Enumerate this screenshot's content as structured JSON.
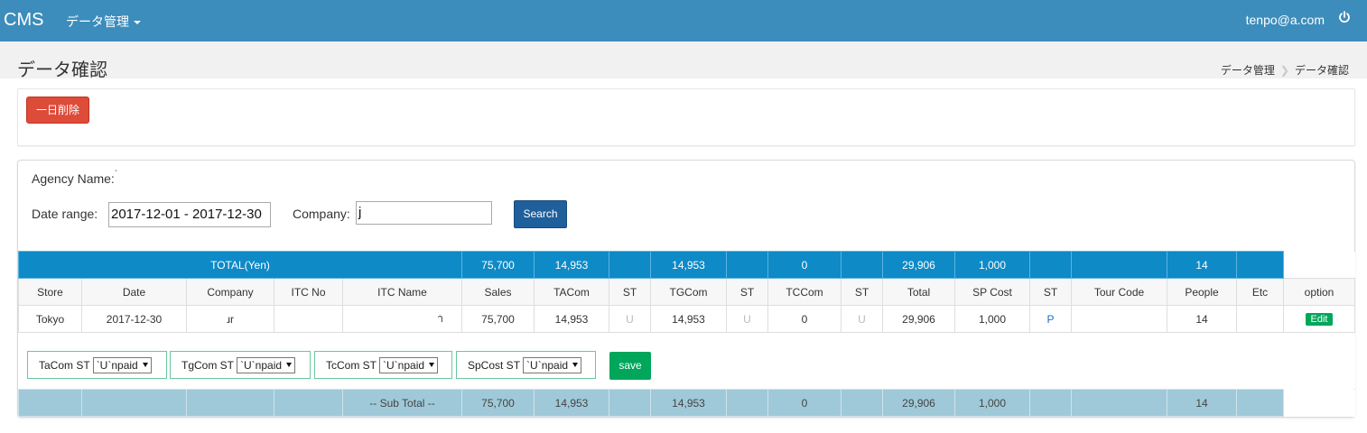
{
  "navbar": {
    "brand": "CMS",
    "menu_label": "データ管理",
    "user_email": "tenpo@a.com"
  },
  "page": {
    "title": "データ確認",
    "breadcrumb": [
      "データ管理",
      "データ確認"
    ]
  },
  "actions": {
    "delete_day_label": "一日削除"
  },
  "search": {
    "agency_label": "Agency Name:",
    "agency_value": "`",
    "date_label": "Date range:",
    "date_value": "2017-12-01 - 2017-12-30",
    "company_label": "Company:",
    "company_value": "j",
    "search_label": "Search"
  },
  "table": {
    "total_row": {
      "label": "TOTAL(Yen)",
      "sales": "75,700",
      "tacom": "14,953",
      "tgcom": "14,953",
      "tccom": "0",
      "total": "29,906",
      "spcost": "1,000",
      "people": "14"
    },
    "headers": [
      "Store",
      "Date",
      "Company",
      "ITC No",
      "ITC Name",
      "Sales",
      "TACom",
      "ST",
      "TGCom",
      "ST",
      "TCCom",
      "ST",
      "Total",
      "SP Cost",
      "ST",
      "Tour Code",
      "People",
      "Etc",
      "option"
    ],
    "rows": [
      {
        "store": "Tokyo",
        "date": "2017-12-30",
        "company": "ɹr",
        "itc_no": "",
        "itc_name": " า",
        "sales": "75,700",
        "tacom": "14,953",
        "ta_st": "U",
        "tgcom": "14,953",
        "tg_st": "U",
        "tccom": "0",
        "tc_st": "U",
        "total": "29,906",
        "spcost": "1,000",
        "sp_st": "P",
        "tour_code": "",
        "people": "14",
        "etc": "",
        "edit_label": "Edit"
      }
    ],
    "subtotal_row": {
      "label": "-- Sub Total --",
      "sales": "75,700",
      "tacom": "14,953",
      "tgcom": "14,953",
      "tccom": "0",
      "total": "29,906",
      "spcost": "1,000",
      "people": "14"
    }
  },
  "status_filters": [
    {
      "label": "TaCom ST",
      "value": "`U`npaid"
    },
    {
      "label": "TgCom ST",
      "value": "`U`npaid"
    },
    {
      "label": "TcCom ST",
      "value": "`U`npaid"
    },
    {
      "label": "SpCost ST",
      "value": "`U`npaid"
    }
  ],
  "save_label": "save",
  "colors": {
    "navbar": "#3c8dbc",
    "total_row": "#0e8ac7",
    "subtotal_row": "#9fc9d9",
    "delete_button": "#dd4b39",
    "search_button": "#1f5f9c",
    "success": "#00a65a"
  }
}
